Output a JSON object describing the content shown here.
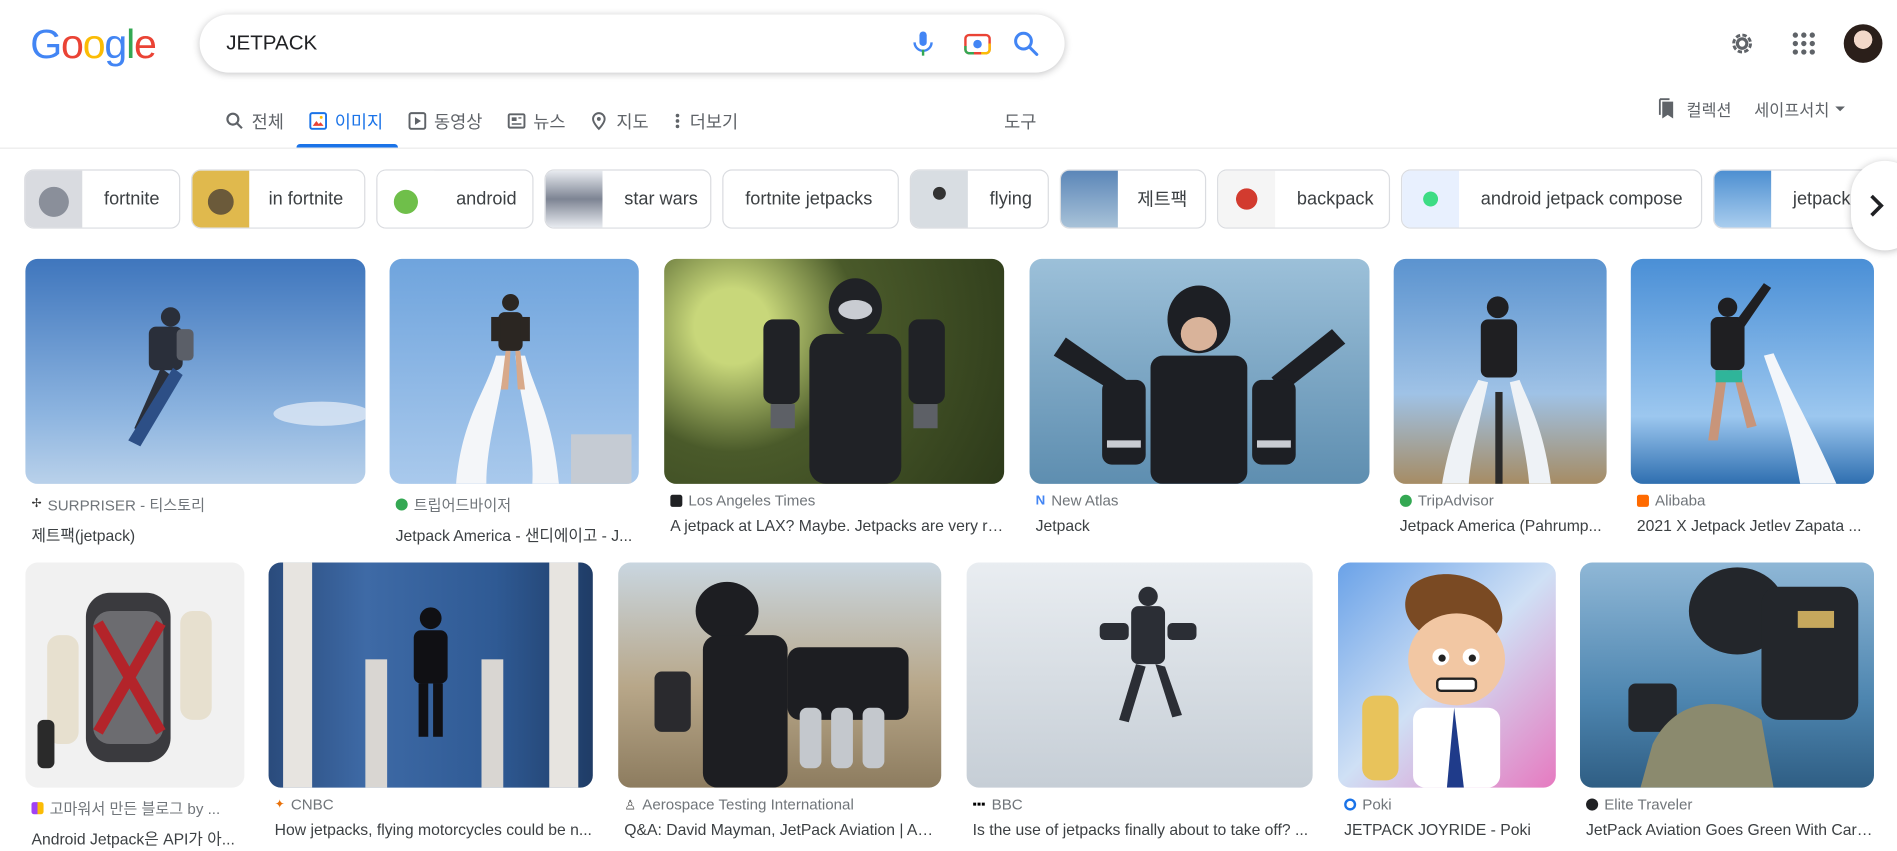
{
  "header": {
    "logo_letters": [
      "G",
      "o",
      "o",
      "g",
      "l",
      "e"
    ],
    "logo_colors": [
      "#4285f4",
      "#ea4335",
      "#fbbc05",
      "#4285f4",
      "#34a853",
      "#ea4335"
    ],
    "search_value": "JETPACK",
    "icons": {
      "mic": "microphone-icon",
      "lens": "camera-lens-icon",
      "search": "search-icon",
      "settings": "gear-icon",
      "apps": "apps-grid-icon"
    }
  },
  "tabs": [
    {
      "label": "전체",
      "icon": "search-icon",
      "active": false
    },
    {
      "label": "이미지",
      "icon": "image-icon",
      "active": true
    },
    {
      "label": "동영상",
      "icon": "video-icon",
      "active": false
    },
    {
      "label": "뉴스",
      "icon": "news-icon",
      "active": false
    },
    {
      "label": "지도",
      "icon": "map-pin-icon",
      "active": false
    },
    {
      "label": "더보기",
      "icon": "more-vert-icon",
      "active": false
    }
  ],
  "tools_label": "도구",
  "collection_label": "컬렉션",
  "safesearch_label": "세이프서치",
  "chips": [
    {
      "label": "fortnite"
    },
    {
      "label": "in fortnite"
    },
    {
      "label": "android"
    },
    {
      "label": "star wars"
    },
    {
      "label": "fortnite jetpacks"
    },
    {
      "label": "flying"
    },
    {
      "label": "제트팩"
    },
    {
      "label": "backpack"
    },
    {
      "label": "android jetpack compose"
    },
    {
      "label": "jetpack a"
    }
  ],
  "results": [
    {
      "source": "SURPRISER - 티스토리",
      "title": "제트팩(jetpack)"
    },
    {
      "source": "트립어드바이저",
      "title": "Jetpack America - 샌디에이고 - J..."
    },
    {
      "source": "Los Angeles Times",
      "title": "A jetpack at LAX? Maybe. Jetpacks are very re..."
    },
    {
      "source": "New Atlas",
      "title": "Jetpack"
    },
    {
      "source": "TripAdvisor",
      "title": "Jetpack America (Pahrump..."
    },
    {
      "source": "Alibaba",
      "title": "2021 X Jetpack Jetlev Zapata ..."
    },
    {
      "source": "고마워서 만든 블로그 by ...",
      "title": "Android Jetpack은 API가 아..."
    },
    {
      "source": "CNBC",
      "title": "How jetpacks, flying motorcycles could be n..."
    },
    {
      "source": "Aerospace Testing International",
      "title": "Q&A: David Mayman, JetPack Aviation | Aer..."
    },
    {
      "source": "BBC",
      "title": "Is the use of jetpacks finally about to take off? ..."
    },
    {
      "source": "Poki",
      "title": "JETPACK JOYRIDE - Poki"
    },
    {
      "source": "Elite Traveler",
      "title": "JetPack Aviation Goes Green With Carb..."
    }
  ],
  "colors": {
    "accent": "#1a73e8",
    "text_secondary": "#5f6368"
  }
}
